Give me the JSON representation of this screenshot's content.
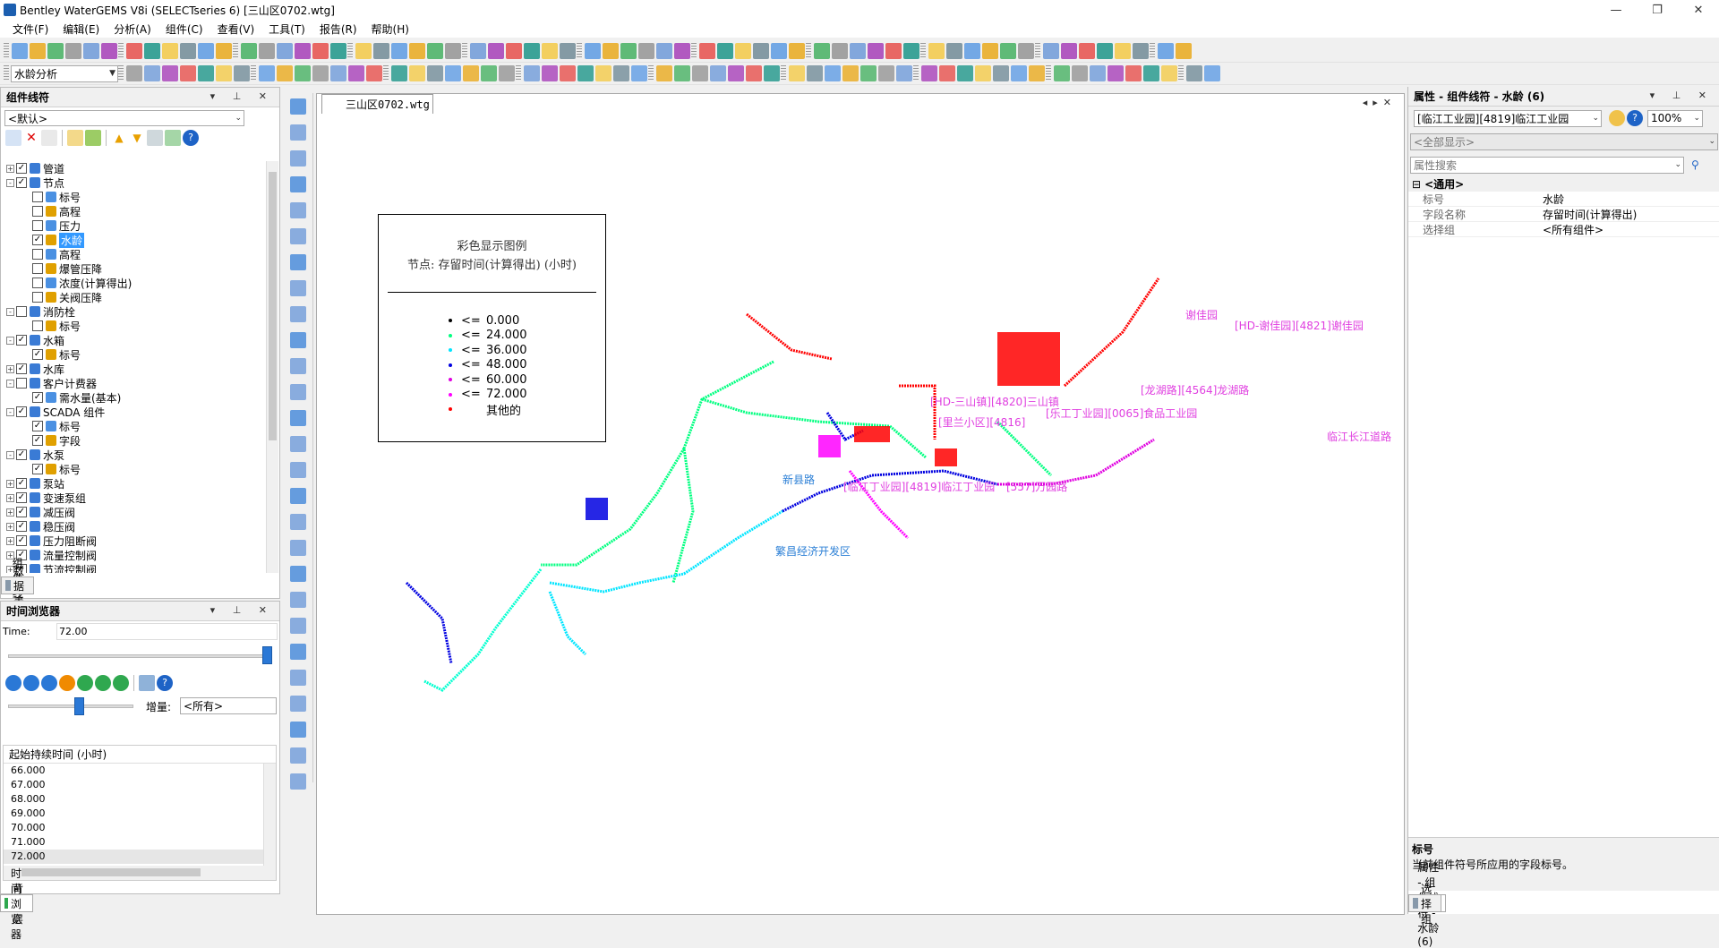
{
  "window": {
    "title": "Bentley WaterGEMS V8i (SELECTseries 6) [三山区0702.wtg]",
    "min": "—",
    "max": "❐",
    "close": "✕"
  },
  "menu": [
    "文件(F)",
    "编辑(E)",
    "分析(A)",
    "组件(C)",
    "查看(V)",
    "工具(T)",
    "报告(R)",
    "帮助(H)"
  ],
  "toolbar": {
    "scenario_combo": "水龄分析"
  },
  "element_symbology": {
    "title": "组件线符",
    "default_combo": "<默认>",
    "tree": [
      {
        "label": "管道",
        "level": 0,
        "pm": "+",
        "checked": true
      },
      {
        "label": "节点",
        "level": 0,
        "pm": "-",
        "checked": true
      },
      {
        "label": "标号",
        "level": 1,
        "checked": false
      },
      {
        "label": "高程",
        "level": 1,
        "checked": false
      },
      {
        "label": "压力",
        "level": 1,
        "checked": false
      },
      {
        "label": "水龄",
        "level": 1,
        "checked": true,
        "selected": true
      },
      {
        "label": "高程",
        "level": 1,
        "checked": false
      },
      {
        "label": "爆管压降",
        "level": 1,
        "checked": false
      },
      {
        "label": "浓度(计算得出)",
        "level": 1,
        "checked": false
      },
      {
        "label": "关阀压降",
        "level": 1,
        "checked": false
      },
      {
        "label": "消防栓",
        "level": 0,
        "pm": "-",
        "checked": false
      },
      {
        "label": "标号",
        "level": 1,
        "checked": false
      },
      {
        "label": "水箱",
        "level": 0,
        "pm": "-",
        "checked": true
      },
      {
        "label": "标号",
        "level": 1,
        "checked": true
      },
      {
        "label": "水库",
        "level": 0,
        "pm": "+",
        "checked": true
      },
      {
        "label": "客户计费器",
        "level": 0,
        "pm": "-",
        "checked": false
      },
      {
        "label": "需水量(基本)",
        "level": 1,
        "checked": true
      },
      {
        "label": "SCADA 组件",
        "level": 0,
        "pm": "-",
        "checked": true
      },
      {
        "label": "标号",
        "level": 1,
        "checked": true
      },
      {
        "label": "字段",
        "level": 1,
        "checked": true
      },
      {
        "label": "水泵",
        "level": 0,
        "pm": "-",
        "checked": true
      },
      {
        "label": "标号",
        "level": 1,
        "checked": true
      },
      {
        "label": "泵站",
        "level": 0,
        "pm": "+",
        "checked": true
      },
      {
        "label": "变速泵组",
        "level": 0,
        "pm": "+",
        "checked": true
      },
      {
        "label": "减压阀",
        "level": 0,
        "pm": "+",
        "checked": true
      },
      {
        "label": "稳压阀",
        "level": 0,
        "pm": "+",
        "checked": true
      },
      {
        "label": "压力阻断阀",
        "level": 0,
        "pm": "+",
        "checked": true
      },
      {
        "label": "流量控制阀",
        "level": 0,
        "pm": "+",
        "checked": true
      },
      {
        "label": "节流控制阀",
        "level": 0,
        "pm": "+",
        "checked": true
      }
    ],
    "tabs": [
      "组件线符",
      "数据表"
    ]
  },
  "time_browser": {
    "title": "时间浏览器",
    "time_label": "Time:",
    "time_value": "72.00",
    "slider_fraction": 1.0,
    "increment_label": "增量:",
    "increment_value": "<所有>",
    "list_header": "起始持续时间 (小时)",
    "times": [
      "66.000",
      "67.000",
      "68.000",
      "69.000",
      "70.000",
      "71.000",
      "72.000"
    ],
    "bottom_tabs": [
      "背景层",
      "时间浏览器"
    ]
  },
  "document": {
    "tab": "三山区0702.wtg",
    "legend": {
      "title1": "彩色显示图例",
      "title2": "节点: 存留时间(计算得出) (小时)",
      "items": [
        {
          "op": "<=",
          "value": "0.000",
          "color": "#000000"
        },
        {
          "op": "<=",
          "value": "24.000",
          "color": "#00ff80"
        },
        {
          "op": "<=",
          "value": "36.000",
          "color": "#00e5ff"
        },
        {
          "op": "<=",
          "value": "48.000",
          "color": "#0000e0"
        },
        {
          "op": "<=",
          "value": "60.000",
          "color": "#e000e0"
        },
        {
          "op": "<=",
          "value": "72.000",
          "color": "#ff00ff"
        },
        {
          "op": "",
          "value": "其他的",
          "color": "#ff0000"
        }
      ]
    },
    "map_labels": [
      "[HD-谢佳园][4821]谢佳园",
      "谢佳园",
      "[龙湖路][4564]龙湖路",
      "[HD-三山镇][4820]三山镇",
      "[里兰小区][4816]",
      "[乐工丁业园][0065]食品工业园",
      "[临江丁业园][4819]临江丁业园",
      "[557]万园路",
      "临江长江道路",
      "新县路",
      "繁昌经济开发区"
    ]
  },
  "properties": {
    "title": "属性 - 组件线符 - 水龄 (6)",
    "element_combo": "[临江工业园][4819]临江工业园",
    "zoom": "100%",
    "filter_combo": "<全部显示>",
    "search_placeholder": "属性搜索",
    "section": "<通用>",
    "rows": [
      {
        "k": "标号",
        "v": "水龄"
      },
      {
        "k": "字段名称",
        "v": "存留时间(计算得出)"
      },
      {
        "k": "选择组",
        "v": "<所有组件>"
      }
    ],
    "help_title": "标号",
    "help_text": "当前组件符号所应用的字段标号。",
    "bottom_tabs": [
      "属性 - 组件线符 - 水龄 (6)",
      "选择组"
    ]
  }
}
